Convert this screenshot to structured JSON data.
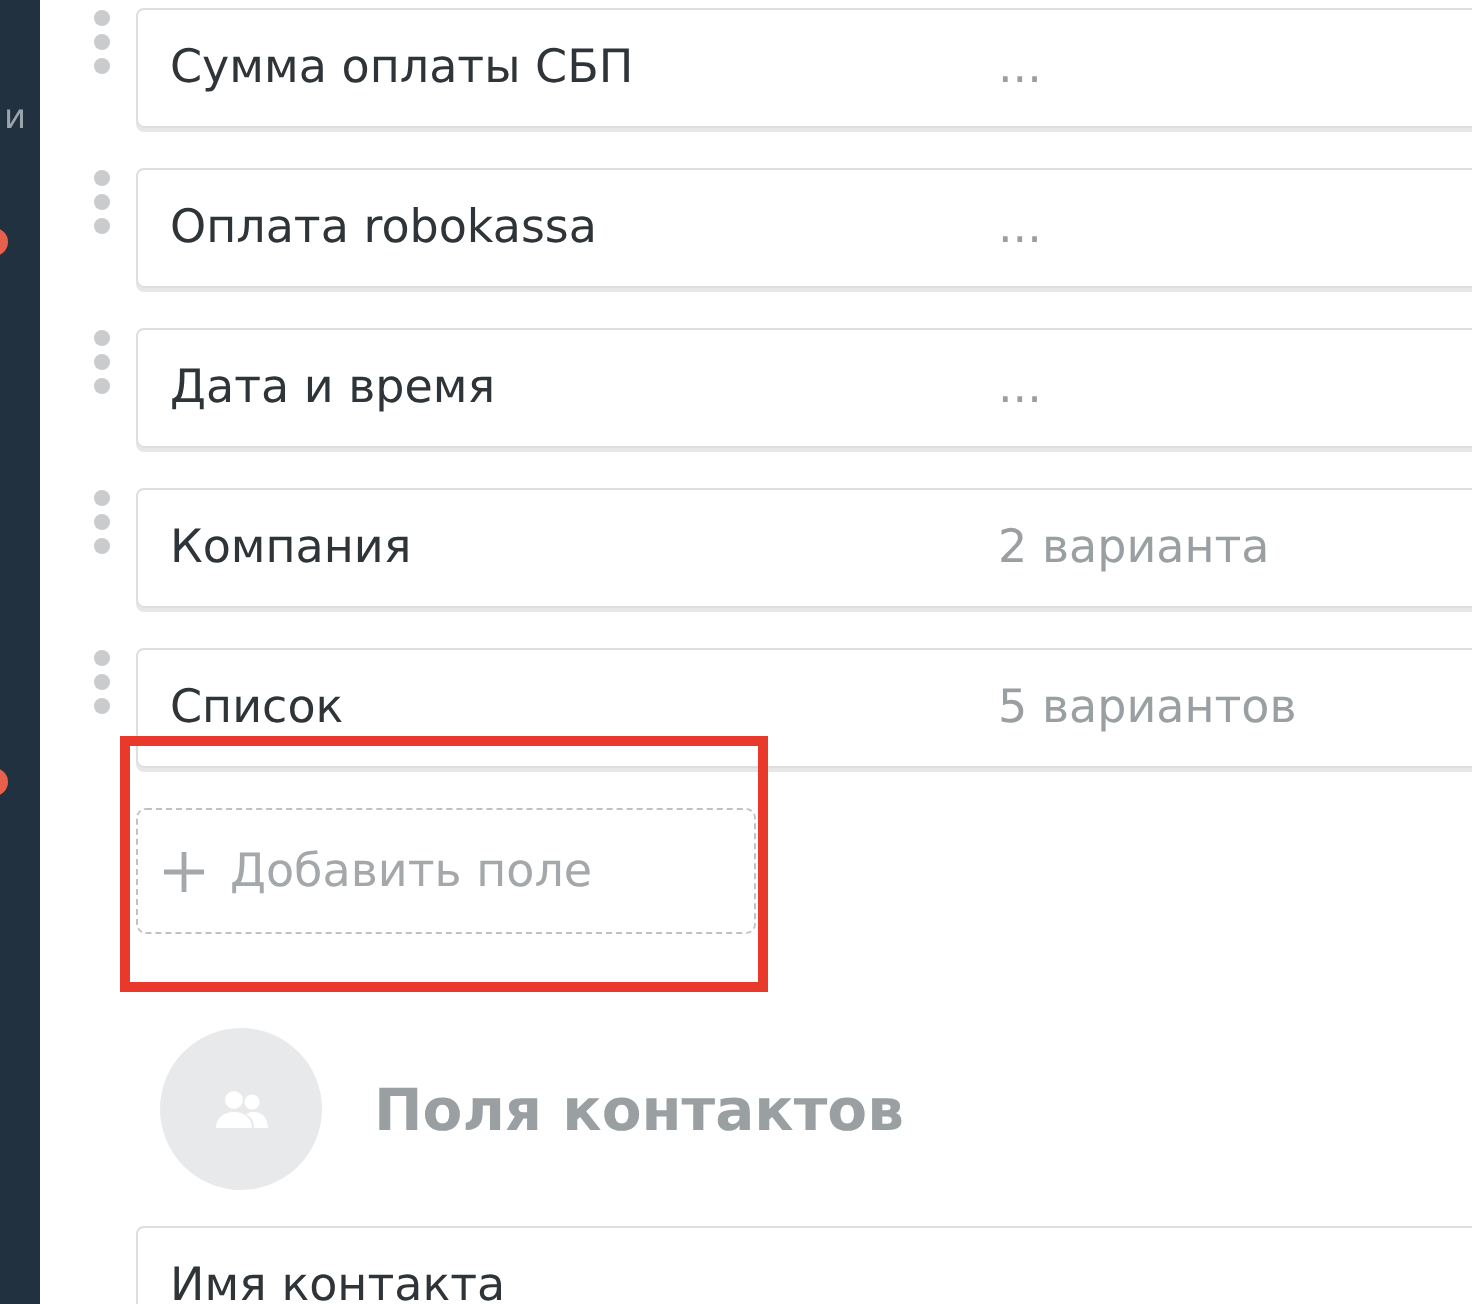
{
  "sidebar": {
    "text": "и",
    "badges": [
      {
        "color": "#e8604c"
      },
      {
        "color": "#e8604c"
      }
    ]
  },
  "fields": [
    {
      "label": "Сумма оплаты СБП",
      "value": "..."
    },
    {
      "label": "Оплата robokassa",
      "value": "..."
    },
    {
      "label": "Дата и время",
      "value": "..."
    },
    {
      "label": "Компания",
      "value": "2 варианта"
    },
    {
      "label": "Список",
      "value": "5 вариантов"
    }
  ],
  "add_field": {
    "label": "Добавить поле",
    "highlighted": true
  },
  "contacts_section": {
    "title": "Поля контактов",
    "fields": [
      {
        "label": "Имя контакта"
      }
    ]
  }
}
